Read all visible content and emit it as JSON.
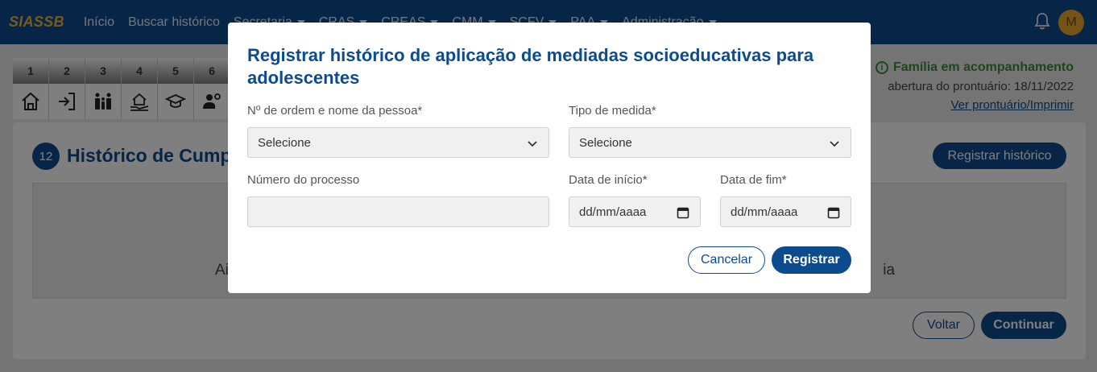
{
  "navbar": {
    "brand": "SIASSB",
    "links": [
      "Início",
      "Buscar histórico"
    ],
    "menus": [
      "Secretaria",
      "CRAS",
      "CREAS",
      "CMM",
      "SCFV",
      "PAA",
      "Administração"
    ],
    "avatar_initial": "M",
    "icons": [
      "bell-icon"
    ]
  },
  "stepper": {
    "numbers": [
      "1",
      "2",
      "3",
      "4",
      "5",
      "6"
    ],
    "icons": [
      "home-icon",
      "login-icon",
      "family-icon",
      "house-hand-icon",
      "graduation-cap-icon",
      "person-gear-icon"
    ]
  },
  "status": {
    "family": "Família em acompanhamento",
    "opening": "abertura do prontuário: 18/11/2022",
    "link": "Ver prontuário/Imprimir"
  },
  "card": {
    "badge": "12",
    "title": "Histórico de Cump",
    "register_button": "Registrar histórico",
    "empty_left": "Ai",
    "empty_right": "ia",
    "back_button": "Voltar",
    "continue_button": "Continuar"
  },
  "modal": {
    "title": "Registrar histórico de aplicação de mediadas socioeducativas para adolescentes",
    "person_label": "Nº de ordem e nome da pessoa*",
    "person_value": "Selecione",
    "measure_label": "Tipo de medida*",
    "measure_value": "Selecione",
    "process_label": "Número do processo",
    "process_value": "",
    "start_label": "Data de início*",
    "start_placeholder": "dd/mm/aaaa",
    "end_label": "Data de fim*",
    "end_placeholder": "dd/mm/aaaa",
    "cancel_button": "Cancelar",
    "register_button": "Registrar"
  },
  "colors": {
    "primary": "#0d4b8f",
    "brand": "#f0b43a",
    "success": "#3a8c3a",
    "avatar": "#e8a72b"
  }
}
